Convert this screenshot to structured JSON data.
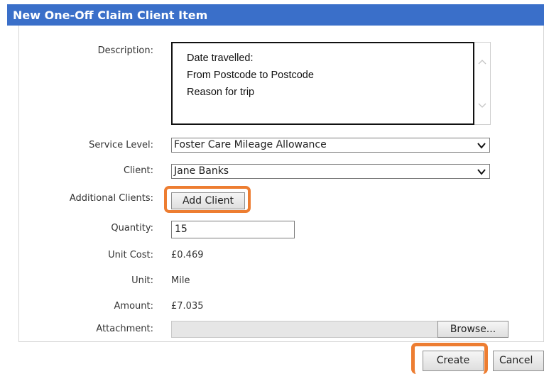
{
  "window": {
    "title": "New One-Off Claim Client Item"
  },
  "form": {
    "description": {
      "label": "Description:",
      "lines": [
        "Date travelled:",
        "From Postcode to Postcode",
        "Reason for trip"
      ]
    },
    "service_level": {
      "label": "Service Level:",
      "value": "Foster Care Mileage Allowance"
    },
    "client": {
      "label": "Client:",
      "value": "Jane Banks"
    },
    "additional_clients": {
      "label": "Additional Clients:",
      "button_label": "Add Client"
    },
    "quantity": {
      "label": "Quantity:",
      "value": "15"
    },
    "unit_cost": {
      "label": "Unit Cost:",
      "value": "£0.469"
    },
    "unit": {
      "label": "Unit:",
      "value": "Mile"
    },
    "amount": {
      "label": "Amount:",
      "value": "£7.035"
    },
    "attachment": {
      "label": "Attachment:",
      "browse_label": "Browse..."
    }
  },
  "actions": {
    "create_label": "Create",
    "cancel_label": "Cancel"
  },
  "colors": {
    "title_bar": "#3a6fc9",
    "highlight_ring": "#ed7d31"
  },
  "icons": [
    "scroll-up-icon",
    "scroll-down-icon",
    "chevron-down-icon"
  ]
}
